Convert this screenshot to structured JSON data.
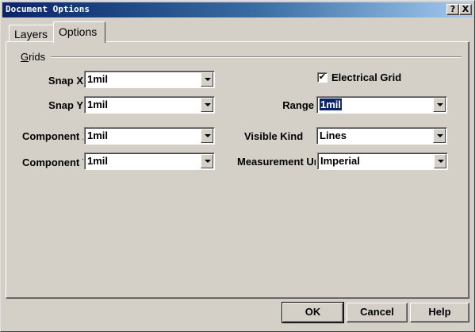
{
  "window": {
    "title": "Document Options",
    "help_button": "?",
    "close_button": "X"
  },
  "tabs": [
    {
      "label": "Layers",
      "active": false
    },
    {
      "label": "Options",
      "active": true
    }
  ],
  "grids": {
    "group_label_accel": "G",
    "group_label_rest": "rids",
    "snap_x": {
      "label": "Snap X",
      "value": "1mil"
    },
    "snap_y": {
      "label": "Snap Y",
      "value": "1mil"
    },
    "component_x": {
      "label": "Component X",
      "value": "1mil"
    },
    "component_y": {
      "label": "Component Y",
      "value": "1mil"
    },
    "electrical_grid": {
      "label": "Electrical Grid",
      "checked": true,
      "check_glyph": "✔"
    },
    "range": {
      "label": "Range",
      "value": "1mil"
    },
    "visible_kind": {
      "label": "Visible Kind",
      "value": "Lines"
    },
    "measurement_unit": {
      "label": "Measurement Unit",
      "value": "Imperial"
    }
  },
  "buttons": {
    "ok": "OK",
    "cancel": "Cancel",
    "help": "Help"
  }
}
